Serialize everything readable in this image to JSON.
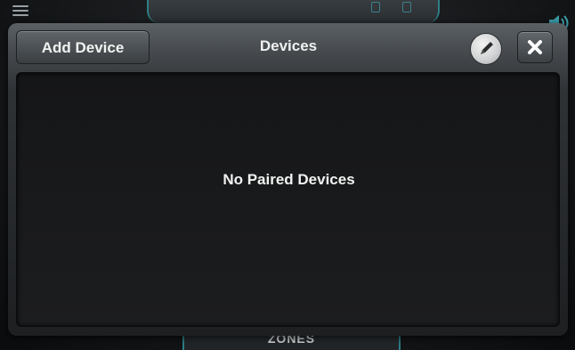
{
  "background": {
    "zones_label": "ZONES"
  },
  "dialog": {
    "title": "Devices",
    "add_device_label": "Add Device",
    "empty_message": "No Paired Devices"
  },
  "colors": {
    "accent": "#2d7f87",
    "dialog_body": "#151617",
    "text": "#f2f2f2"
  },
  "icons": {
    "edit": "pencil-icon",
    "close": "close-icon",
    "menu": "hamburger-menu-icon",
    "speaker": "speaker-volume-icon"
  }
}
